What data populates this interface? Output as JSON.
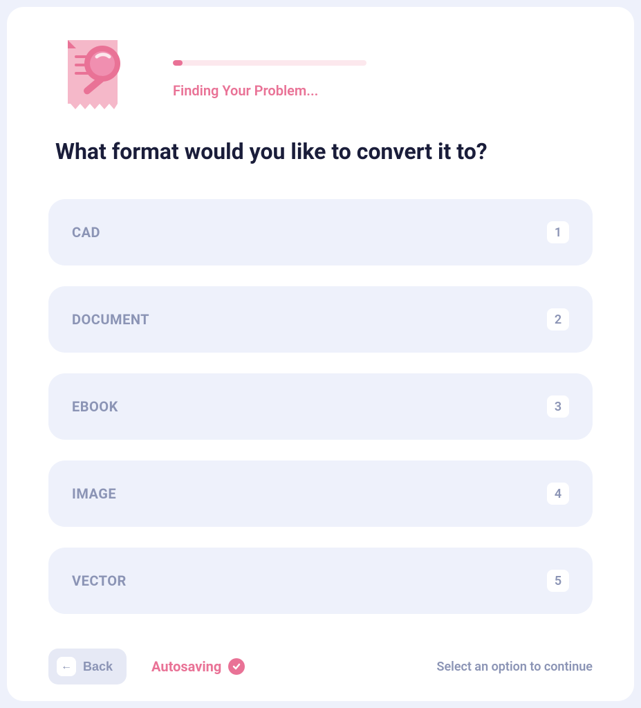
{
  "header": {
    "progress_text": "Finding Your Problem..."
  },
  "question": {
    "title": "What format would you like to convert it to?"
  },
  "options": [
    {
      "label": "CAD",
      "number": "1"
    },
    {
      "label": "DOCUMENT",
      "number": "2"
    },
    {
      "label": "EBOOK",
      "number": "3"
    },
    {
      "label": "IMAGE",
      "number": "4"
    },
    {
      "label": "VECTOR",
      "number": "5"
    }
  ],
  "footer": {
    "back_label": "Back",
    "autosaving_label": "Autosaving",
    "continue_hint": "Select an option to continue"
  }
}
